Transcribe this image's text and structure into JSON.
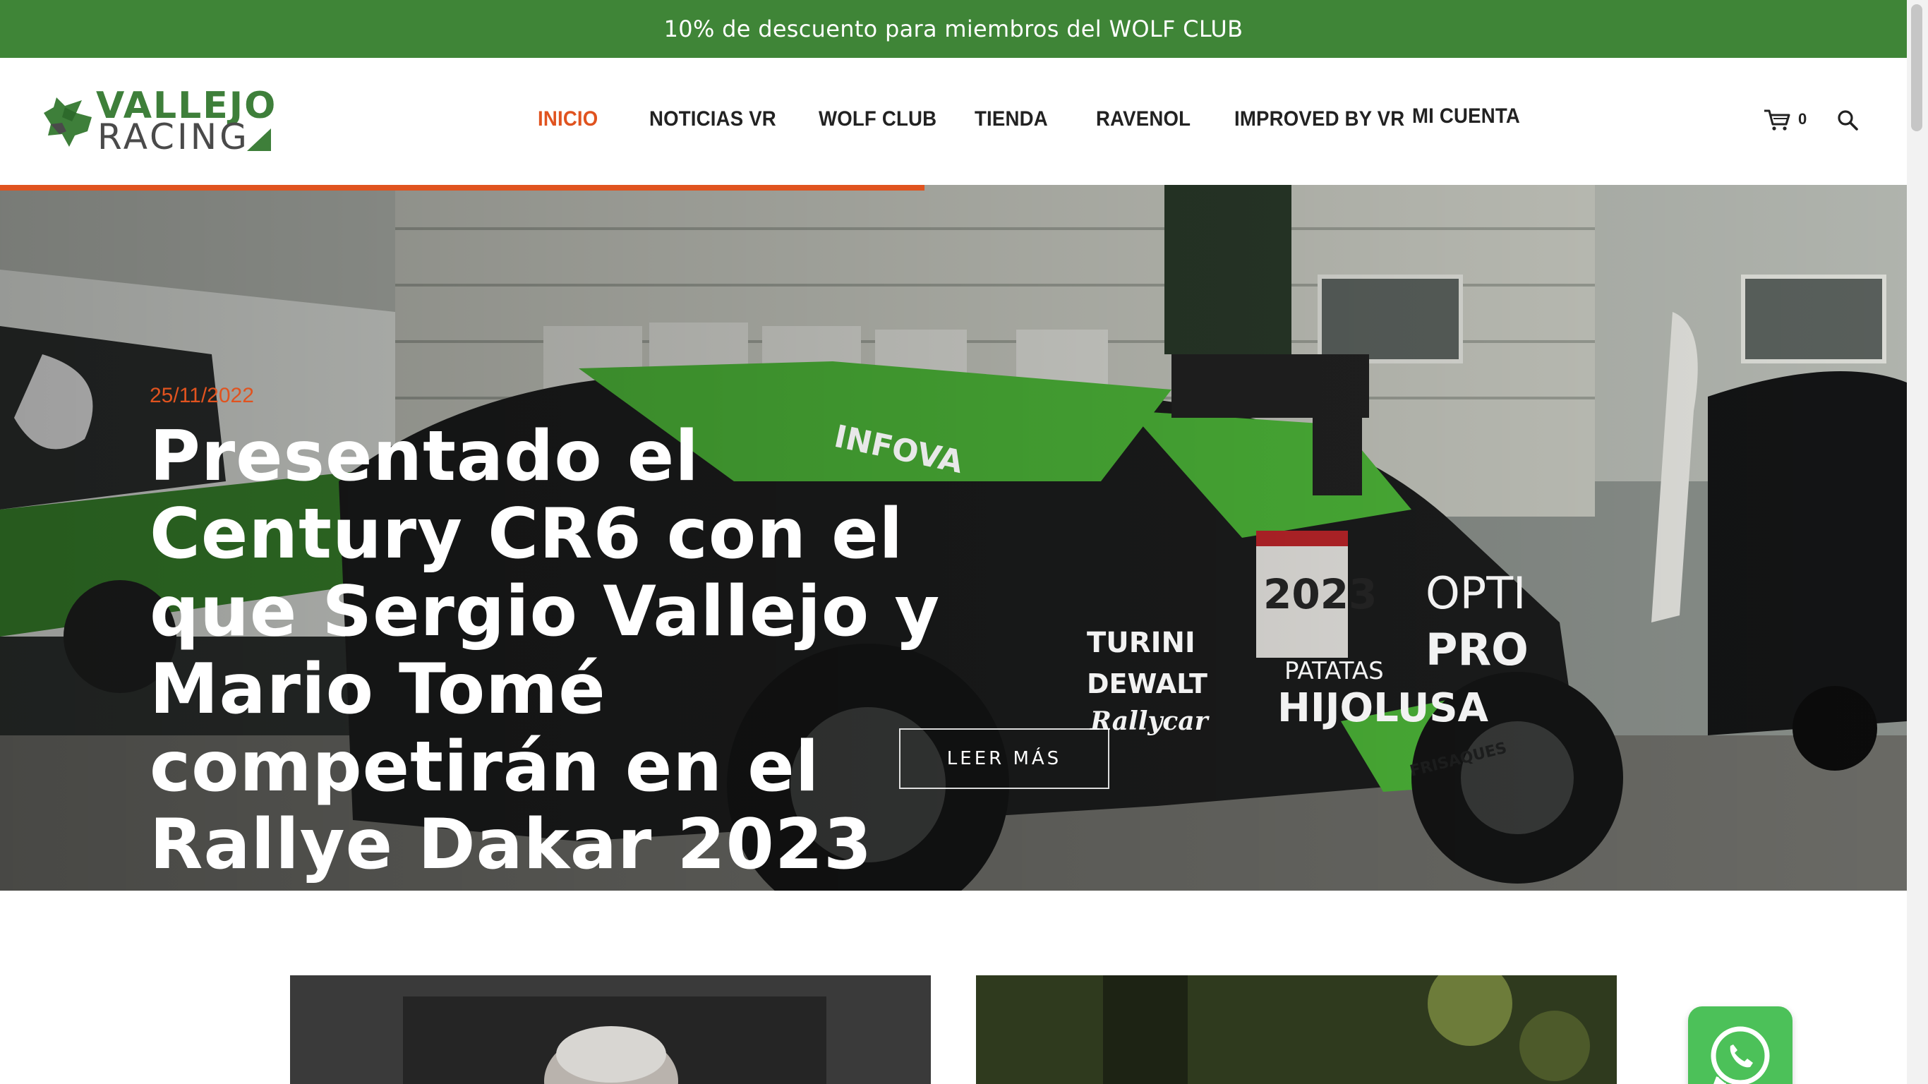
{
  "promo": {
    "text": "10% de descuento para miembros del WOLF CLUB"
  },
  "brand": {
    "line1": "VALLEJO",
    "line2": "RACING",
    "accent": "#3e7f3a"
  },
  "nav": {
    "items": [
      {
        "label": "INICIO",
        "active": true
      },
      {
        "label": "NOTICIAS VR",
        "active": false
      },
      {
        "label": "WOLF CLUB",
        "active": false
      },
      {
        "label": "TIENDA",
        "active": false
      },
      {
        "label": "RAVENOL",
        "active": false
      },
      {
        "label": "IMPROVED BY VR",
        "active": false
      },
      {
        "label": "MI CUENTA",
        "active": false
      }
    ],
    "cart_count": "0",
    "icons": {
      "cart": "cart-icon",
      "search": "search-icon"
    }
  },
  "hero": {
    "date": "25/11/2022",
    "title": "Presentado el Century CR6 con el que Sergio Vallejo y Mario Tomé competirán en el Rallye Dakar 2023",
    "cta": "LEER MÁS",
    "car_decals": {
      "race_number": "2023",
      "sponsors": [
        "INFOVA",
        "TURINI",
        "DEWALT",
        "Rallycar",
        "PATATAS",
        "HIJOLUSA",
        "OPTI",
        "PRO",
        "FRISAQUES"
      ]
    }
  },
  "colors": {
    "promo_bg": "#3f8537",
    "accent_orange": "#e0531f",
    "whatsapp": "#4cc159"
  }
}
